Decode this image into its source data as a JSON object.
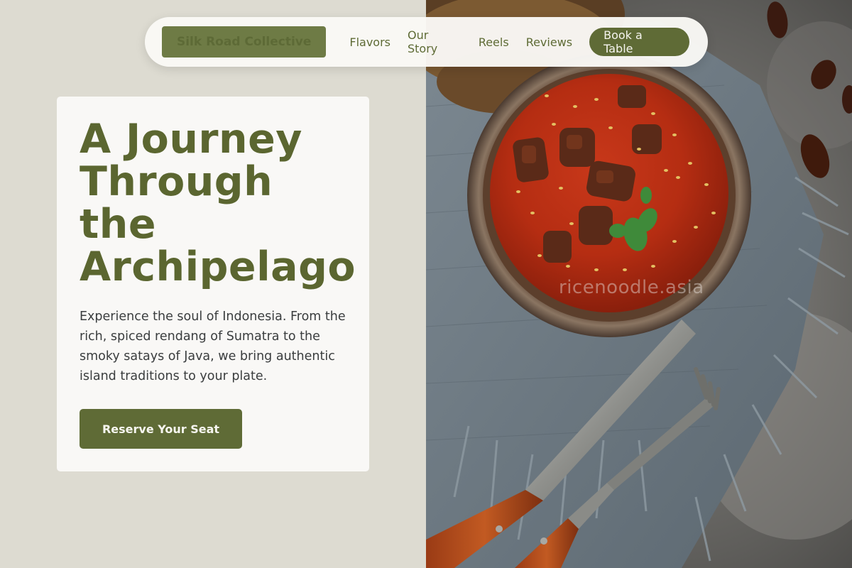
{
  "nav": {
    "brand": "Silk Road Collective",
    "links": [
      "Flavors",
      "Our Story",
      "Reels",
      "Reviews"
    ],
    "cta": "Book a Table"
  },
  "hero": {
    "headline_lines": [
      "A Journey",
      "Through",
      "the",
      "Archipelago"
    ],
    "description": "Experience the soul of Indonesia. From the rich, spiced rendang of Sumatra to the smoky satays of Java, we bring authentic island traditions to your plate.",
    "cta": "Reserve Your Seat"
  },
  "image": {
    "watermark": "ricenoodle.asia"
  },
  "colors": {
    "accent": "#5f6b36",
    "background": "#dddbd1",
    "card": "#f9f8f6",
    "body_text": "#3a3d3e"
  },
  "icons": [
    "food-photo"
  ]
}
